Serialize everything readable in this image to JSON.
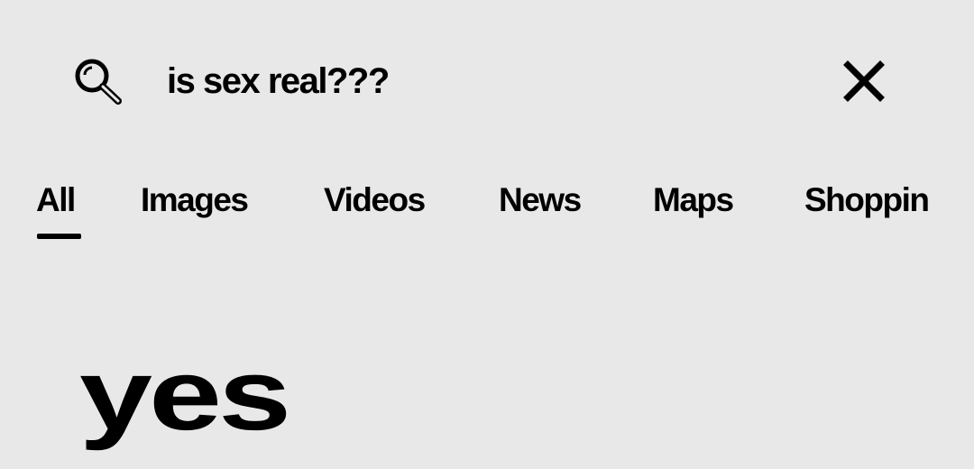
{
  "search": {
    "query": "is sex real???",
    "search_icon": "search-icon",
    "clear_icon": "close-icon"
  },
  "tabs": [
    {
      "label": "All",
      "selected": true
    },
    {
      "label": "Images",
      "selected": false
    },
    {
      "label": "Videos",
      "selected": false
    },
    {
      "label": "News",
      "selected": false
    },
    {
      "label": "Maps",
      "selected": false
    },
    {
      "label": "Shoppin",
      "selected": false
    }
  ],
  "result": {
    "answer": "yes"
  },
  "colors": {
    "background": "#e8e8e8",
    "text": "#000000",
    "tab_indicator": "#000000"
  }
}
